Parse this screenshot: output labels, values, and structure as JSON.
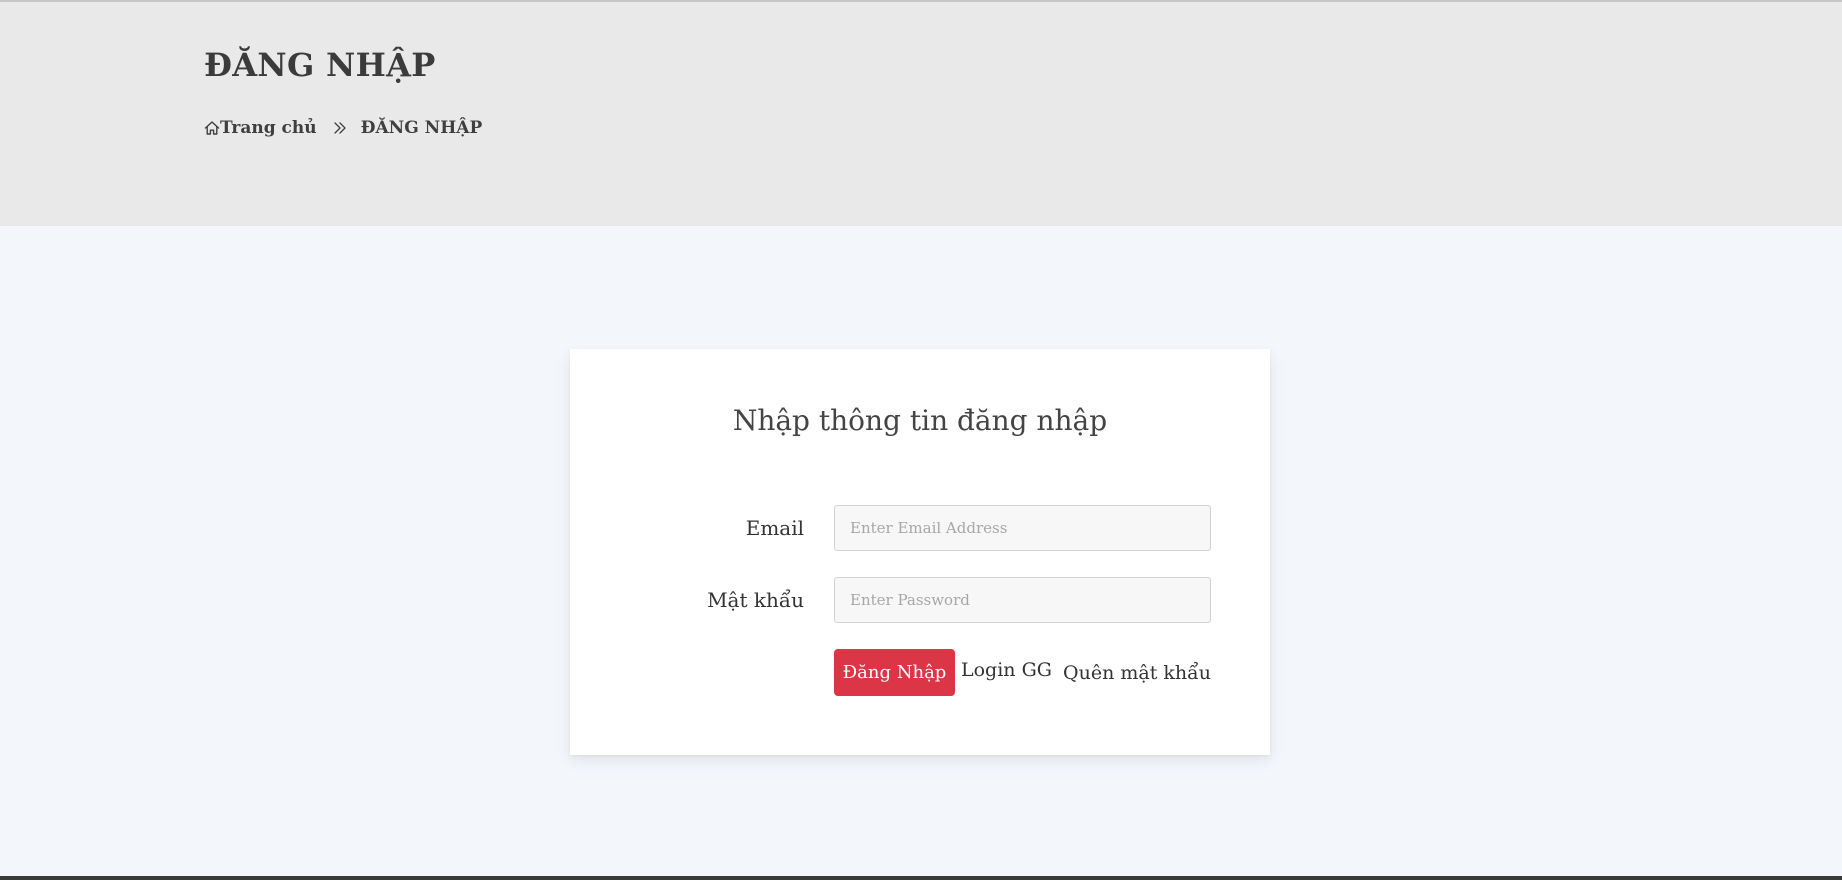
{
  "header": {
    "title": "ĐĂNG NHẬP",
    "breadcrumb": {
      "home_label": "Trang chủ",
      "current_label": "ĐĂNG NHẬP"
    }
  },
  "login_form": {
    "heading": "Nhập thông tin đăng nhập",
    "email_label": "Email",
    "email_placeholder": "Enter Email Address",
    "email_value": "",
    "password_label": "Mật khẩu",
    "password_placeholder": "Enter Password",
    "password_value": "",
    "submit_label": "Đăng Nhập",
    "google_login_label": "Login GG",
    "forgot_password_label": "Quên mật khẩu"
  },
  "icons": {
    "home": "home-icon",
    "separator": "double-chevron-right-icon"
  },
  "colors": {
    "banner_bg": "#e9e9e9",
    "page_bg": "#f3f7fc",
    "primary_button": "#dc3545",
    "text": "#3a3a3a"
  }
}
